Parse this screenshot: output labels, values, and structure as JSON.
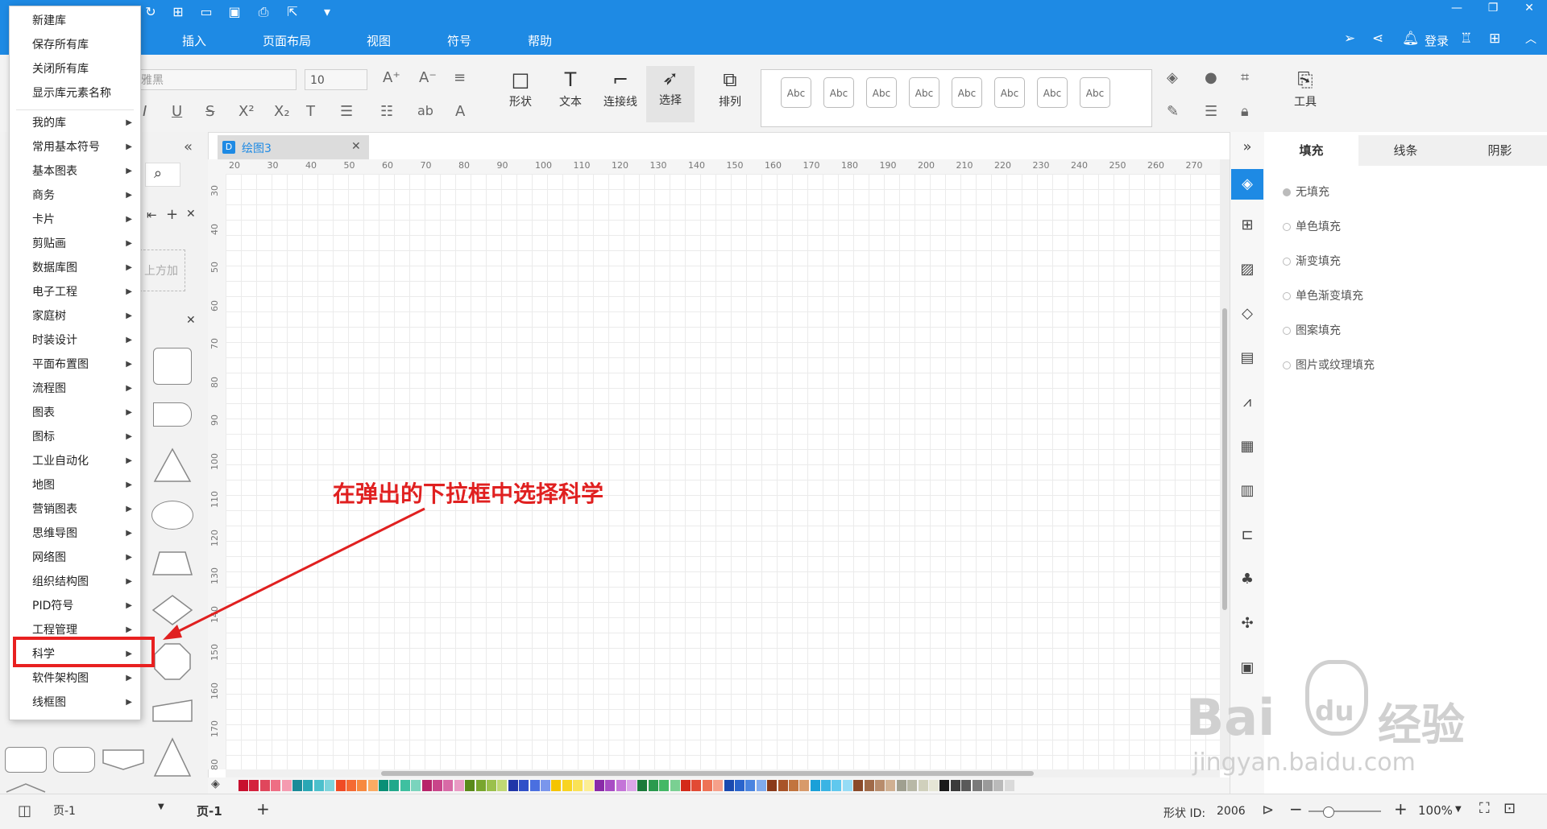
{
  "menu_tabs": [
    "插入",
    "页面布局",
    "视图",
    "符号",
    "帮助"
  ],
  "login_label": "登录",
  "ribbon": {
    "font_name": "雅黑",
    "font_size": "10",
    "tools": {
      "shape": "形状",
      "text": "文本",
      "connector": "连接线",
      "select": "选择",
      "arrange": "排列",
      "tools": "工具"
    },
    "style_samples": [
      "Abc",
      "Abc",
      "Abc",
      "Abc",
      "Abc",
      "Abc",
      "Abc",
      "Abc"
    ]
  },
  "library_panel": {
    "drop_hint": "上方加"
  },
  "dropdown": {
    "top_items": [
      "新建库",
      "保存所有库",
      "关闭所有库",
      "显示库元素名称"
    ],
    "categories": [
      "我的库",
      "常用基本符号",
      "基本图表",
      "商务",
      "卡片",
      "剪贴画",
      "数据库图",
      "电子工程",
      "家庭树",
      "时装设计",
      "平面布置图",
      "流程图",
      "图表",
      "图标",
      "工业自动化",
      "地图",
      "营销图表",
      "思维导图",
      "网络图",
      "组织结构图",
      "PID符号",
      "工程管理",
      "科学",
      "软件架构图",
      "线框图"
    ]
  },
  "doc_tab": "绘图3",
  "ruler": {
    "h": [
      "20",
      "30",
      "40",
      "50",
      "60",
      "70",
      "80",
      "90",
      "100",
      "110",
      "120",
      "130",
      "140",
      "150",
      "160",
      "170",
      "180",
      "190",
      "200",
      "210",
      "220",
      "230",
      "240",
      "250",
      "260",
      "270"
    ],
    "v": [
      "30",
      "40",
      "50",
      "60",
      "70",
      "80",
      "90",
      "100",
      "110",
      "120",
      "130",
      "140",
      "150",
      "160",
      "170",
      "80"
    ]
  },
  "annotation": "在弹出的下拉框中选择科学",
  "right_panel": {
    "tabs": [
      "填充",
      "线条",
      "阴影"
    ],
    "fill_options": [
      "无填充",
      "单色填充",
      "渐变填充",
      "单色渐变填充",
      "图案填充",
      "图片或纹理填充"
    ]
  },
  "status": {
    "page_select": "页-1",
    "page_tab": "页-1",
    "add": "+",
    "shape_id_label": "形状 ID:",
    "shape_id": "2006",
    "zoom": "100%"
  },
  "watermark": {
    "brand": "Bai",
    "paw": "du",
    "cn": "经验",
    "url": "jingyan.baidu.com"
  },
  "palette": [
    "#c8102e",
    "#d4213d",
    "#e0465c",
    "#ee6e84",
    "#f59bb0",
    "#1b8a98",
    "#2aa7b5",
    "#4cc0cc",
    "#7dd4dc",
    "#f04b24",
    "#f56a32",
    "#f7893f",
    "#fbab63",
    "#0a8f76",
    "#21a88b",
    "#3fc0a0",
    "#7ad4bd",
    "#b8246a",
    "#c9458a",
    "#d86aa6",
    "#e99ac4",
    "#5a8a1a",
    "#79a62e",
    "#9bc04c",
    "#c0d874",
    "#2036a8",
    "#3050c8",
    "#4a6fe0",
    "#7a96ec",
    "#f5c400",
    "#f8d422",
    "#fae256",
    "#fcee94",
    "#8a2aa8",
    "#a84cc4",
    "#c474d8",
    "#dca6e8",
    "#1a7a3a",
    "#2a9a4e",
    "#44b866",
    "#7ad092",
    "#d42a1a",
    "#e24a34",
    "#ee7256",
    "#f6a08a",
    "#1a4ab0",
    "#2a64cc",
    "#4a84e0",
    "#80aaee",
    "#8a3a1a",
    "#a85428",
    "#c2743e",
    "#d89a6a",
    "#1aa0d8",
    "#3ab4e4",
    "#60c8ee",
    "#96dcf6",
    "#8a4a2a",
    "#a06a48",
    "#b88c6c",
    "#d0b092",
    "#a0a090",
    "#b8b8a6",
    "#d0d0bc",
    "#e6e6d6",
    "#1a1a1a",
    "#3a3a3a",
    "#5a5a5a",
    "#7a7a7a",
    "#9a9a9a",
    "#bababa",
    "#dadada"
  ]
}
